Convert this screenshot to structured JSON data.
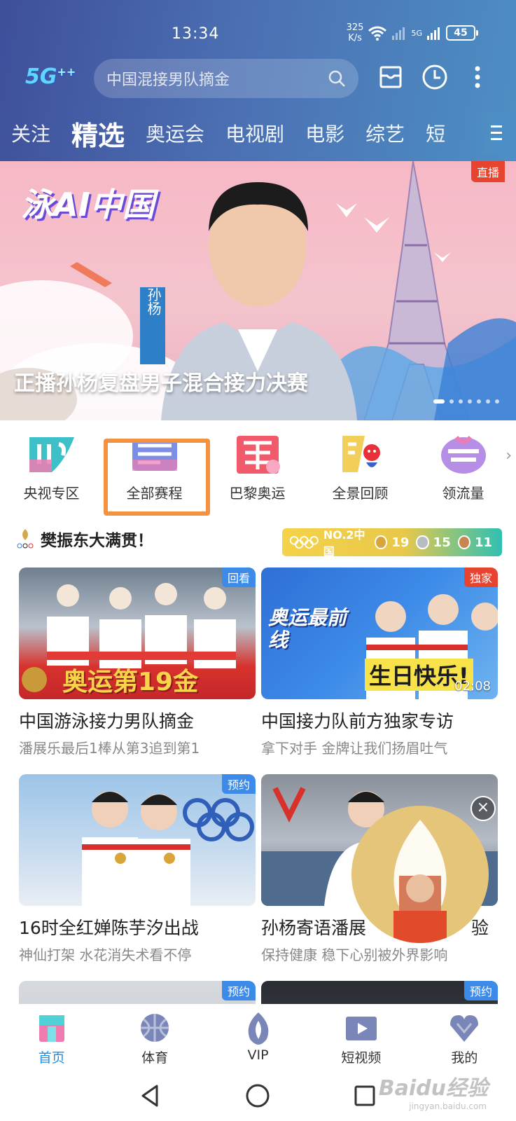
{
  "status_bar": {
    "time": "13:34",
    "net_speed_value": "325",
    "net_speed_unit": "K/s",
    "signal_label": "5G",
    "battery": "45"
  },
  "header": {
    "logo_text": "5G",
    "logo_sup": "++",
    "search_placeholder": "中国混接男队摘金",
    "tabs": [
      {
        "label": "关注"
      },
      {
        "label": "精选"
      },
      {
        "label": "奥运会"
      },
      {
        "label": "电视剧"
      },
      {
        "label": "电影"
      },
      {
        "label": "综艺"
      },
      {
        "label": "短"
      }
    ]
  },
  "banner": {
    "badge": "直播",
    "logo_text": "泳AI中国",
    "name_tag": "孙杨",
    "caption": "正播孙杨复盘男子混合接力决赛"
  },
  "quick_entries": [
    {
      "label": "央视专区",
      "icon": "cctv-zone-icon"
    },
    {
      "label": "全部赛程",
      "icon": "schedule-icon"
    },
    {
      "label": "巴黎奥运",
      "icon": "paris-olympics-icon"
    },
    {
      "label": "全景回顾",
      "icon": "panorama-review-icon"
    },
    {
      "label": "领流量",
      "icon": "data-reward-icon"
    }
  ],
  "section": {
    "title": "樊振东大满贯！",
    "medal_rank": "NO.2中国",
    "gold": "19",
    "silver": "15",
    "bronze": "11"
  },
  "cards": [
    {
      "tag": "回看",
      "overlay": "奥运第19金",
      "title": "中国游泳接力男队摘金",
      "subtitle": "潘展乐最后1棒从第3追到第1",
      "duration": ""
    },
    {
      "tag": "独家",
      "overlay": "生日快乐!",
      "overlay2": "奥运最前线",
      "title": "中国接力队前方独家专访",
      "subtitle": "拿下对手 金牌让我们扬眉吐气",
      "duration": "02:08"
    },
    {
      "tag": "预约",
      "overlay": "",
      "title": "16时全红婵陈芋汐出战",
      "subtitle": "神仙打架 水花消失术看不停",
      "duration": ""
    },
    {
      "tag": "",
      "overlay": "",
      "title": "孙杨寄语潘展",
      "title_tail": "验",
      "subtitle": "保持健康 稳下心别被外界影响",
      "duration": ""
    },
    {
      "tag": "预约",
      "overlay": "",
      "title": "",
      "subtitle": "",
      "duration": ""
    },
    {
      "tag": "预约",
      "overlay": "",
      "title": "",
      "subtitle": "",
      "duration": ""
    }
  ],
  "bottom_nav": [
    {
      "label": "首页",
      "icon": "home-icon"
    },
    {
      "label": "体育",
      "icon": "sports-icon"
    },
    {
      "label": "VIP",
      "icon": "vip-icon"
    },
    {
      "label": "短视频",
      "icon": "short-video-icon"
    },
    {
      "label": "我的",
      "icon": "profile-icon"
    }
  ],
  "watermark": {
    "text": "Baidu经验",
    "sub": "jingyan.baidu.com"
  },
  "colors": {
    "accent": "#1f8fe6",
    "highlight": "#f39241",
    "live_red": "#e8432f"
  }
}
